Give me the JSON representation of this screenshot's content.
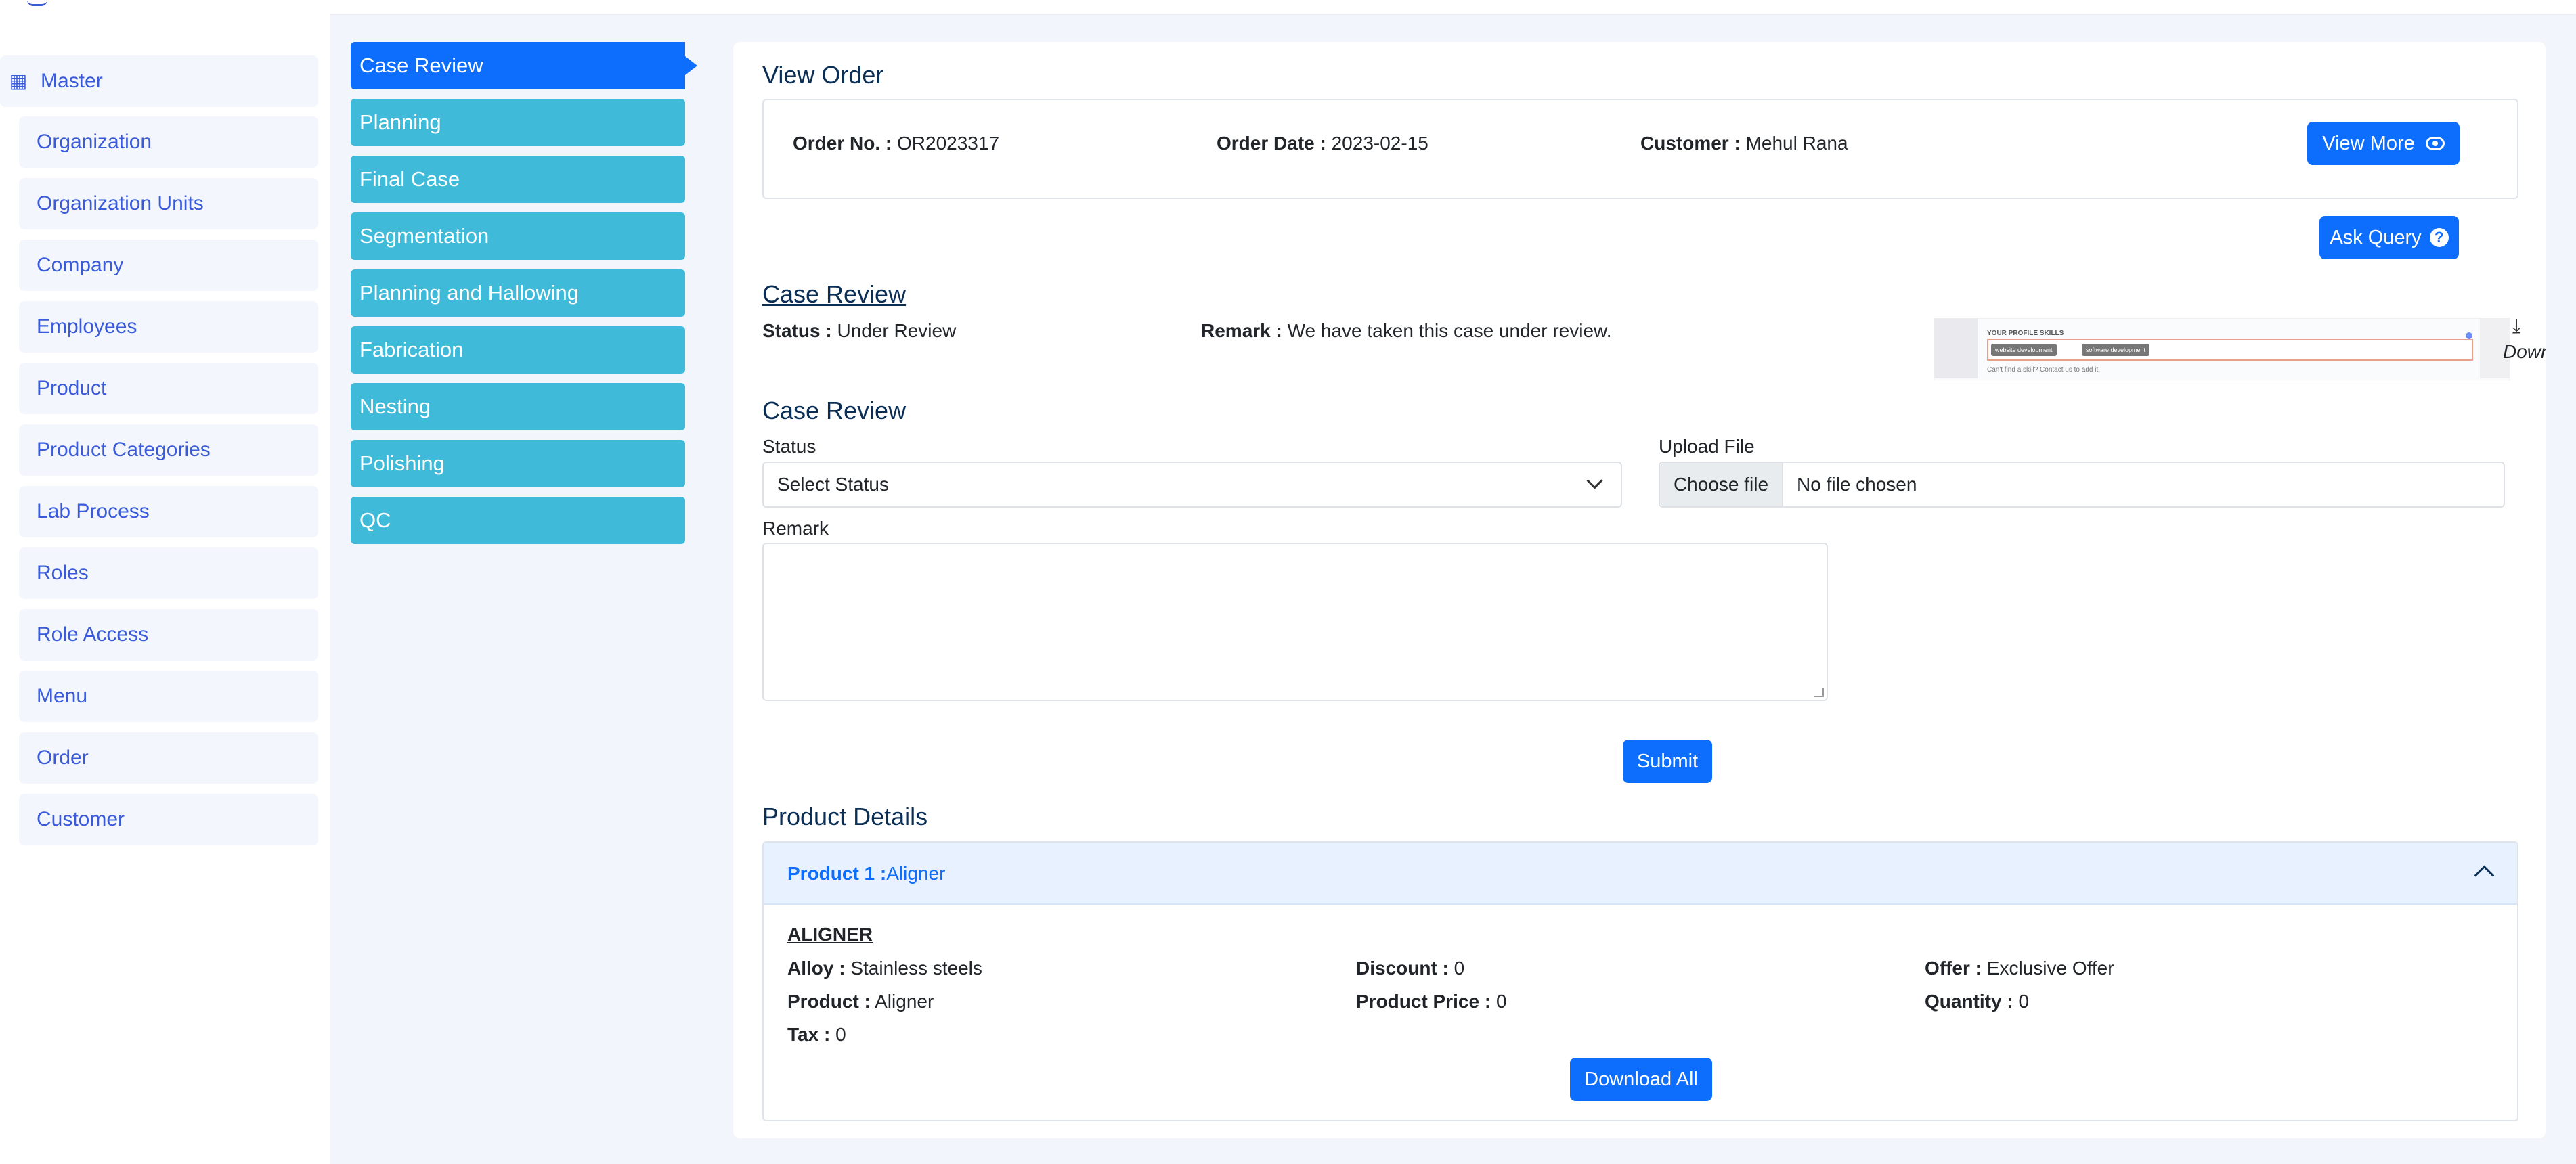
{
  "sidebar": {
    "header": "Master",
    "items": [
      {
        "label": "Organization"
      },
      {
        "label": "Organization Units"
      },
      {
        "label": "Company"
      },
      {
        "label": "Employees"
      },
      {
        "label": "Product"
      },
      {
        "label": "Product Categories"
      },
      {
        "label": "Lab Process"
      },
      {
        "label": "Roles"
      },
      {
        "label": "Role Access"
      },
      {
        "label": "Menu"
      },
      {
        "label": "Order"
      },
      {
        "label": "Customer"
      }
    ]
  },
  "steps": [
    {
      "label": "Case Review",
      "active": true
    },
    {
      "label": "Planning"
    },
    {
      "label": "Final Case"
    },
    {
      "label": "Segmentation"
    },
    {
      "label": "Planning and Hallowing"
    },
    {
      "label": "Fabrication"
    },
    {
      "label": "Nesting"
    },
    {
      "label": "Polishing"
    },
    {
      "label": "QC"
    }
  ],
  "view_order": {
    "title": "View Order",
    "order_no_label": "Order No. :",
    "order_no": "OR2023317",
    "order_date_label": "Order Date :",
    "order_date": "2023-02-15",
    "customer_label": "Customer :",
    "customer": "Mehul Rana",
    "view_more": "View More",
    "ask_query": "Ask Query"
  },
  "case_review_info": {
    "title": "Case Review",
    "status_label": "Status :",
    "status": "Under Review",
    "remark_label": "Remark :",
    "remark": "We have taken this case under review.",
    "download": "Download",
    "attachment": {
      "heading": "YOUR PROFILE SKILLS",
      "chip1": "website development",
      "chip2": "software development",
      "hint": "Can't find a skill? Contact us to add it."
    }
  },
  "case_review_form": {
    "title": "Case Review",
    "status_label": "Status",
    "status_value": "Select Status",
    "upload_label": "Upload File",
    "choose_file": "Choose file",
    "no_file": "No file chosen",
    "remark_label": "Remark",
    "submit": "Submit"
  },
  "product_details": {
    "title": "Product Details",
    "accordion_label": "Product 1 :",
    "accordion_value": "Aligner",
    "name": "ALIGNER",
    "alloy_label": "Alloy :",
    "alloy": "Stainless steels",
    "discount_label": "Discount :",
    "discount": "0",
    "offer_label": "Offer :",
    "offer": "Exclusive Offer",
    "product_label": "Product :",
    "product": "Aligner",
    "price_label": "Product Price :",
    "price": "0",
    "quantity_label": "Quantity :",
    "quantity": "0",
    "tax_label": "Tax :",
    "tax": "0",
    "download_all": "Download All"
  },
  "colors": {
    "primary": "#0d6efd",
    "step": "#3fbad8",
    "sidebar_text": "#3a5bd9",
    "heading": "#0b2e55"
  }
}
